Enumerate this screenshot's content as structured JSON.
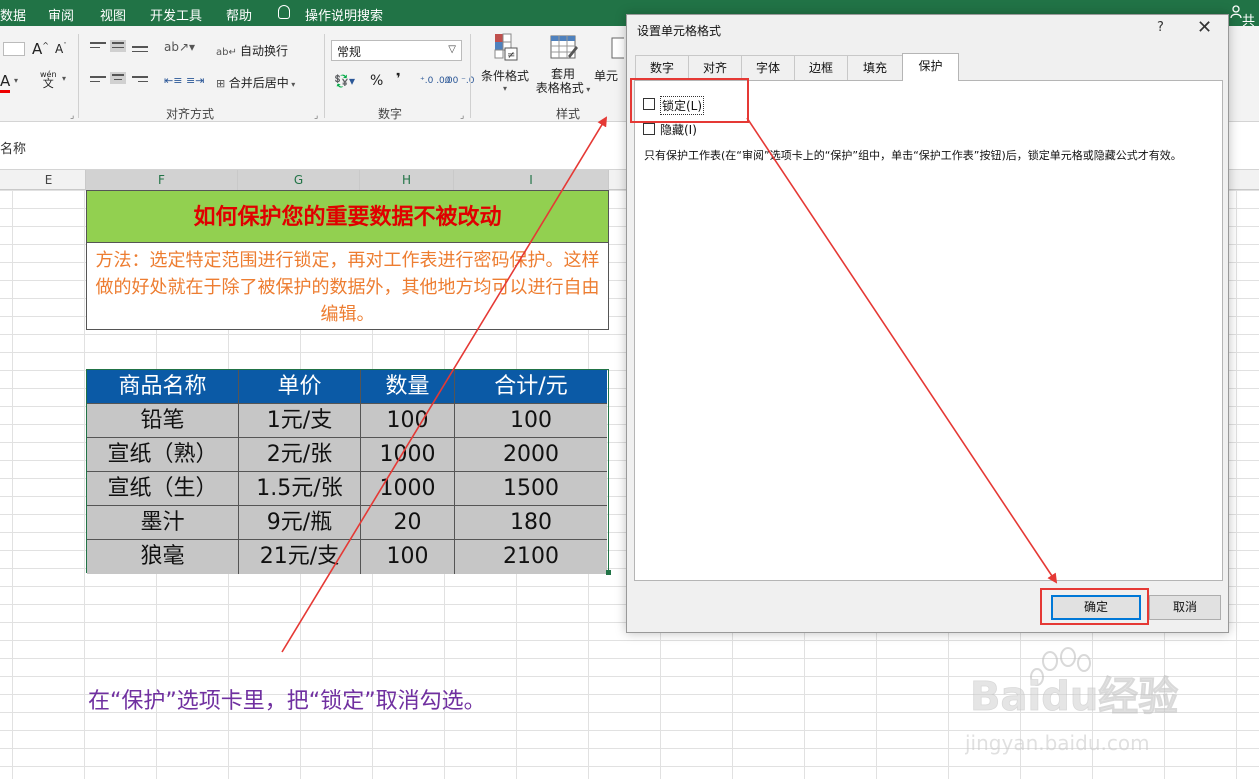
{
  "ribbon_tabs": [
    "数据",
    "审阅",
    "视图",
    "开发工具",
    "帮助",
    "操作说明搜索"
  ],
  "share_label": "共",
  "ribbon": {
    "wrap_text": "自动换行",
    "merge_center": "合并后居中",
    "number_format": "常规",
    "percent": "%",
    "comma": "❜",
    "inc_decimal": "⁺.0 .00",
    "dec_decimal": ".00 ⁻.0",
    "wen_label": "wén",
    "wen_char": "文",
    "cond_format": "条件格式",
    "table_format_1": "套用",
    "table_format_2": "表格格式",
    "cell_styles": "单元",
    "font_a": "A",
    "groups": {
      "alignment": "对齐方式",
      "number": "数字",
      "styles": "样式"
    }
  },
  "formula_bar": {
    "name_box": "名称"
  },
  "columns": [
    "E",
    "F",
    "G",
    "H",
    "I"
  ],
  "sheet": {
    "title": "如何保护您的重要数据不被改动",
    "method": "方法：选定特定范围进行锁定，再对工作表进行密码保护。这样做的好处就在于除了被保护的数据外，其他地方均可以进行自由编辑。",
    "table": {
      "headers": [
        "商品名称",
        "单价",
        "数量",
        "合计/元"
      ],
      "rows": [
        [
          "铅笔",
          "1元/支",
          "100",
          "100"
        ],
        [
          "宣纸（熟）",
          "2元/张",
          "1000",
          "2000"
        ],
        [
          "宣纸（生）",
          "1.5元/张",
          "1000",
          "1500"
        ],
        [
          "墨汁",
          "9元/瓶",
          "20",
          "180"
        ],
        [
          "狼毫",
          "21元/支",
          "100",
          "2100"
        ]
      ]
    },
    "note": "在“保护”选项卡里，把“锁定”取消勾选。"
  },
  "dialog": {
    "title": "设置单元格格式",
    "help": "?",
    "close": "✕",
    "tabs": [
      "数字",
      "对齐",
      "字体",
      "边框",
      "填充",
      "保护"
    ],
    "active_tab": "保护",
    "locked_label": "锁定(L)",
    "locked_checked": false,
    "hidden_label": "隐藏(I)",
    "hidden_checked": false,
    "description": "只有保护工作表(在“审阅”选项卡上的“保护”组中，单击“保护工作表”按钮)后，锁定单元格或隐藏公式才有效。",
    "ok": "确定",
    "cancel": "取消"
  },
  "watermark": {
    "brand": "Baidu经验",
    "url": "jingyan.baidu.com"
  },
  "colors": {
    "excel_green": "#217346",
    "title_green": "#92d050",
    "title_red": "#e00000",
    "method_orange": "#ed7d31",
    "header_blue": "#0b5aa6",
    "note_purple": "#7030a0",
    "annotation_red": "#e53935"
  }
}
